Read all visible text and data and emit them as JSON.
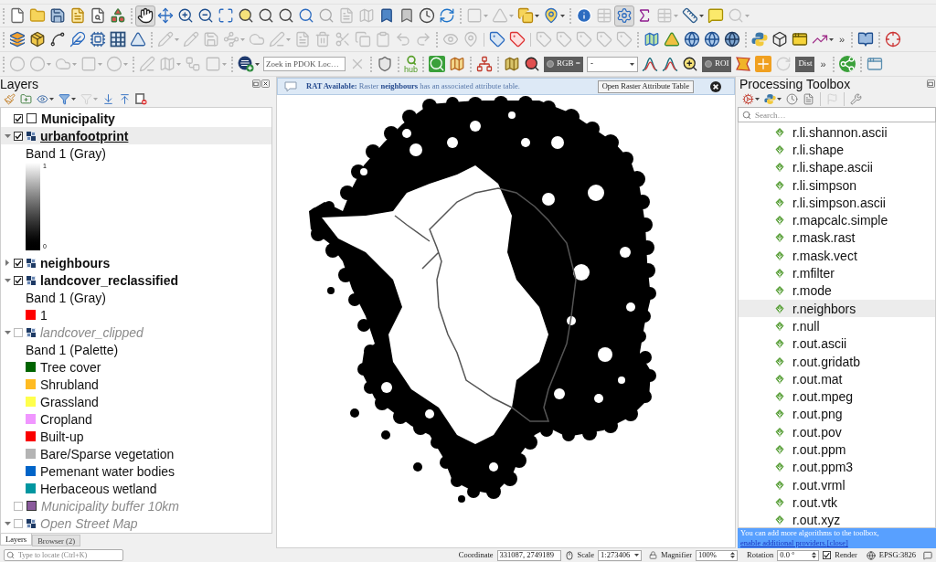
{
  "toolbar_rows": [
    {
      "toolbars": [
        {
          "tools": [
            {
              "kind": "button",
              "disabled": false,
              "selected": false
            },
            {
              "kind": "button",
              "disabled": false,
              "selected": false
            },
            {
              "kind": "button",
              "disabled": false,
              "selected": false
            },
            {
              "kind": "button",
              "disabled": false,
              "selected": false
            },
            {
              "kind": "button",
              "disabled": false,
              "selected": false
            },
            {
              "kind": "button",
              "disabled": false,
              "selected": false
            }
          ]
        },
        {
          "tools": [
            {
              "kind": "button",
              "disabled": false,
              "selected": true
            },
            {
              "kind": "button",
              "disabled": false,
              "selected": false
            },
            {
              "kind": "button",
              "disabled": false,
              "selected": false
            },
            {
              "kind": "button",
              "disabled": false,
              "selected": false
            },
            {
              "kind": "button",
              "disabled": false,
              "selected": false
            },
            {
              "kind": "button",
              "disabled": false,
              "selected": false
            },
            {
              "kind": "button",
              "disabled": false,
              "selected": false
            },
            {
              "kind": "button",
              "disabled": false,
              "selected": false
            },
            {
              "kind": "button",
              "disabled": false,
              "selected": false
            },
            {
              "kind": "button",
              "disabled": true,
              "selected": false
            },
            {
              "kind": "button",
              "disabled": true,
              "selected": false
            },
            {
              "kind": "button",
              "disabled": true,
              "selected": false
            },
            {
              "kind": "button",
              "disabled": false,
              "selected": false
            },
            {
              "kind": "button",
              "disabled": false,
              "selected": false
            },
            {
              "kind": "button",
              "disabled": false,
              "selected": false
            },
            {
              "kind": "button",
              "disabled": false,
              "selected": false
            }
          ]
        },
        {
          "tools": [
            {
              "kind": "button",
              "disabled": true,
              "selected": false
            },
            {
              "kind": "button",
              "disabled": true,
              "selected": false
            },
            {
              "kind": "button",
              "disabled": false,
              "selected": false
            },
            {
              "kind": "button",
              "disabled": false,
              "selected": false
            }
          ]
        },
        {
          "tools": [
            {
              "kind": "button",
              "disabled": false,
              "selected": false
            },
            {
              "kind": "button",
              "disabled": true,
              "selected": false
            },
            {
              "kind": "button",
              "disabled": false,
              "selected": true
            },
            {
              "kind": "button",
              "disabled": false,
              "selected": false
            },
            {
              "kind": "button",
              "disabled": true,
              "selected": false
            },
            {
              "kind": "button",
              "disabled": false,
              "selected": false
            },
            {
              "kind": "button",
              "disabled": false,
              "selected": false
            },
            {
              "kind": "button",
              "disabled": true,
              "selected": false
            }
          ]
        }
      ]
    },
    {
      "toolbars": [
        {
          "tools": [
            {
              "kind": "button",
              "disabled": false,
              "selected": false
            },
            {
              "kind": "button",
              "disabled": false,
              "selected": false
            },
            {
              "kind": "button",
              "disabled": false,
              "selected": false
            },
            {
              "kind": "button",
              "disabled": false,
              "selected": false
            },
            {
              "kind": "button",
              "disabled": false,
              "selected": false
            },
            {
              "kind": "button",
              "disabled": false,
              "selected": false
            },
            {
              "kind": "button",
              "disabled": false,
              "selected": false
            }
          ]
        },
        {
          "tools": [
            {
              "kind": "button",
              "disabled": true,
              "selected": false
            },
            {
              "kind": "button",
              "disabled": true,
              "selected": false
            },
            {
              "kind": "button",
              "disabled": true,
              "selected": false
            },
            {
              "kind": "button",
              "disabled": true,
              "selected": false
            },
            {
              "kind": "button",
              "disabled": true,
              "selected": false
            },
            {
              "kind": "button",
              "disabled": true,
              "selected": false
            },
            {
              "kind": "button",
              "disabled": true,
              "selected": false
            },
            {
              "kind": "button",
              "disabled": true,
              "selected": false
            },
            {
              "kind": "button",
              "disabled": true,
              "selected": false
            },
            {
              "kind": "button",
              "disabled": true,
              "selected": false
            },
            {
              "kind": "button",
              "disabled": true,
              "selected": false
            },
            {
              "kind": "button",
              "disabled": true,
              "selected": false
            },
            {
              "kind": "button",
              "disabled": true,
              "selected": false
            }
          ]
        },
        {
          "tools": [
            {
              "kind": "button",
              "disabled": true,
              "selected": false
            },
            {
              "kind": "button",
              "disabled": true,
              "selected": false
            },
            {
              "kind": "button",
              "disabled": false,
              "selected": false
            },
            {
              "kind": "button",
              "disabled": false,
              "selected": false
            },
            {
              "kind": "button",
              "disabled": true,
              "selected": false
            },
            {
              "kind": "button",
              "disabled": true,
              "selected": false
            },
            {
              "kind": "button",
              "disabled": true,
              "selected": false
            },
            {
              "kind": "button",
              "disabled": true,
              "selected": false
            },
            {
              "kind": "button",
              "disabled": true,
              "selected": false
            }
          ]
        },
        {
          "tools": [
            {
              "kind": "button",
              "disabled": false,
              "selected": false
            },
            {
              "kind": "button",
              "disabled": false,
              "selected": false
            },
            {
              "kind": "button",
              "disabled": false,
              "selected": false
            },
            {
              "kind": "button",
              "disabled": false,
              "selected": false
            },
            {
              "kind": "button",
              "disabled": false,
              "selected": false
            }
          ]
        },
        {
          "tools": [
            {
              "kind": "button",
              "disabled": false,
              "selected": false
            },
            {
              "kind": "button",
              "disabled": false,
              "selected": false
            },
            {
              "kind": "button",
              "disabled": false,
              "selected": false
            },
            {
              "kind": "button",
              "disabled": false,
              "selected": false
            },
            {
              "kind": "more",
              "text": "»"
            }
          ]
        },
        {
          "tools": [
            {
              "kind": "button",
              "disabled": false,
              "selected": false
            }
          ]
        },
        {
          "tools": [
            {
              "kind": "button",
              "disabled": false,
              "selected": false
            }
          ]
        }
      ]
    },
    {
      "toolbars": [
        {
          "tools": [
            {
              "kind": "button",
              "disabled": true,
              "selected": false
            },
            {
              "kind": "button",
              "disabled": true,
              "selected": false
            },
            {
              "kind": "button",
              "disabled": true,
              "selected": false
            },
            {
              "kind": "button",
              "disabled": true,
              "selected": false
            },
            {
              "kind": "button",
              "disabled": true,
              "selected": false
            }
          ]
        },
        {
          "tools": [
            {
              "kind": "button",
              "disabled": true,
              "selected": false
            },
            {
              "kind": "button",
              "disabled": true,
              "selected": false
            },
            {
              "kind": "button",
              "disabled": true,
              "selected": false
            },
            {
              "kind": "button",
              "disabled": true,
              "selected": false
            }
          ]
        },
        {
          "tools": [
            {
              "kind": "button",
              "disabled": false,
              "selected": false
            },
            {
              "kind": "search",
              "placeholder": "Zoek in PDOK Loc…"
            },
            {
              "kind": "button",
              "disabled": true,
              "selected": false
            }
          ]
        },
        {
          "tools": [
            {
              "kind": "button",
              "disabled": false,
              "selected": false
            }
          ]
        },
        {
          "tools": [
            {
              "kind": "button",
              "label": "hub",
              "disabled": false,
              "selected": false
            }
          ]
        },
        {
          "tools": [
            {
              "kind": "button",
              "disabled": false,
              "selected": false
            },
            {
              "kind": "button",
              "disabled": false,
              "selected": false
            }
          ]
        },
        {
          "tools": [
            {
              "kind": "button",
              "disabled": false,
              "selected": false
            }
          ]
        },
        {
          "tools": [
            {
              "kind": "button",
              "disabled": false,
              "selected": false
            },
            {
              "kind": "button",
              "disabled": false,
              "selected": false
            },
            {
              "kind": "toggle",
              "text": "RGB =",
              "indicator": true
            },
            {
              "kind": "combo",
              "value": "-"
            },
            {
              "kind": "button",
              "disabled": false,
              "selected": false
            },
            {
              "kind": "button",
              "disabled": false,
              "selected": false
            },
            {
              "kind": "button",
              "disabled": false,
              "selected": false
            },
            {
              "kind": "toggle",
              "text": "ROI",
              "indicator": true
            },
            {
              "kind": "button",
              "disabled": false,
              "selected": false
            },
            {
              "kind": "button",
              "disabled": false,
              "selected": false
            },
            {
              "kind": "button",
              "disabled": true,
              "selected": false
            },
            {
              "kind": "toggle",
              "text": "Dist",
              "indicator": false
            },
            {
              "kind": "more",
              "text": "»"
            }
          ]
        },
        {
          "tools": [
            {
              "kind": "button",
              "disabled": false,
              "selected": false
            }
          ]
        },
        {
          "tools": [
            {
              "kind": "button",
              "disabled": false,
              "selected": false
            }
          ]
        }
      ]
    }
  ],
  "layers_panel": {
    "title": "Layers",
    "tools": [
      {
        "disabled": false
      },
      {
        "disabled": false
      },
      {
        "disabled": false
      },
      {
        "disabled": false
      },
      {
        "disabled": true
      },
      {
        "disabled": false
      },
      {
        "disabled": false
      },
      {
        "disabled": false
      }
    ],
    "layers": [
      {
        "name": "Municipality",
        "kind": "vector",
        "color": "#ffffff",
        "checked": true,
        "selected": false
      },
      {
        "name": "urbanfootprint",
        "kind": "raster",
        "checked": true,
        "selected": true,
        "expanded": true,
        "legend": {
          "band": "Band 1 (Gray)",
          "kind": "gradient",
          "max": "1",
          "min": "0"
        }
      },
      {
        "name": "neighbours",
        "kind": "raster",
        "checked": true,
        "selected": false,
        "expanded": false
      },
      {
        "name": "landcover_reclassified",
        "kind": "raster",
        "checked": true,
        "selected": false,
        "expanded": true,
        "legend": {
          "band": "Band 1 (Gray)",
          "kind": "classes",
          "classes": [
            {
              "label": "1",
              "color": "#ff0000"
            }
          ]
        }
      },
      {
        "name": "landcover_clipped",
        "kind": "raster",
        "checked": false,
        "selected": false,
        "expanded": true,
        "legend": {
          "band": "Band 1 (Palette)",
          "kind": "classes",
          "classes": [
            {
              "label": "Tree cover",
              "color": "#006400"
            },
            {
              "label": "Shrubland",
              "color": "#ffbb22"
            },
            {
              "label": "Grassland",
              "color": "#ffff4c"
            },
            {
              "label": "Cropland",
              "color": "#f096ff"
            },
            {
              "label": "Built-up",
              "color": "#fa0000"
            },
            {
              "label": "Bare/Sparse vegetation",
              "color": "#b4b4b4"
            },
            {
              "label": "Pemenant water bodies",
              "color": "#0064c8"
            },
            {
              "label": "Herbaceous wetland",
              "color": "#0096a0"
            }
          ]
        }
      },
      {
        "name": "Municipality buffer 10km",
        "kind": "vector",
        "color": "#8a5a9c",
        "checked": false,
        "selected": false
      },
      {
        "name": "Open Street Map",
        "kind": "raster",
        "checked": false,
        "selected": false,
        "expanded": true
      }
    ],
    "tabs": [
      {
        "label": "Layers",
        "selected": true
      },
      {
        "label": "Browser (2)",
        "selected": false
      }
    ]
  },
  "map": {
    "message": {
      "text": "**RAT Available:** Raster **neighbours** has an associated attribute table.",
      "button": "Open Raster Attribute Table"
    }
  },
  "processing_toolbox": {
    "title": "Processing Toolbox",
    "tools": [
      {
        "disabled": false
      },
      {
        "disabled": false
      },
      {
        "disabled": false
      },
      {
        "disabled": false
      },
      {
        "disabled": true
      },
      {
        "disabled": false
      }
    ],
    "search_placeholder": "Search…",
    "algorithms": [
      {
        "name": "r.li.shannon.ascii",
        "selected": false
      },
      {
        "name": "r.li.shape",
        "selected": false
      },
      {
        "name": "r.li.shape.ascii",
        "selected": false
      },
      {
        "name": "r.li.simpson",
        "selected": false
      },
      {
        "name": "r.li.simpson.ascii",
        "selected": false
      },
      {
        "name": "r.mapcalc.simple",
        "selected": false
      },
      {
        "name": "r.mask.rast",
        "selected": false
      },
      {
        "name": "r.mask.vect",
        "selected": false
      },
      {
        "name": "r.mfilter",
        "selected": false
      },
      {
        "name": "r.mode",
        "selected": false
      },
      {
        "name": "r.neighbors",
        "selected": true
      },
      {
        "name": "r.null",
        "selected": false
      },
      {
        "name": "r.out.ascii",
        "selected": false
      },
      {
        "name": "r.out.gridatb",
        "selected": false
      },
      {
        "name": "r.out.mat",
        "selected": false
      },
      {
        "name": "r.out.mpeg",
        "selected": false
      },
      {
        "name": "r.out.png",
        "selected": false
      },
      {
        "name": "r.out.pov",
        "selected": false
      },
      {
        "name": "r.out.ppm",
        "selected": false
      },
      {
        "name": "r.out.ppm3",
        "selected": false
      },
      {
        "name": "r.out.vrml",
        "selected": false
      },
      {
        "name": "r.out.vtk",
        "selected": false
      },
      {
        "name": "r.out.xyz",
        "selected": false
      }
    ],
    "notice": {
      "text": "You can add more algorithms to the toolbox,",
      "link": "enable additional providers.",
      "close": "[close]"
    }
  },
  "status_bar": {
    "locator_placeholder": "Type to locate (Ctrl+K)",
    "coordinate_label": "Coordinate",
    "coordinate": "331087, 2749189",
    "scale_label": "Scale",
    "scale": "1:273406",
    "magnifier_label": "Magnifier",
    "magnifier": "100%",
    "rotation_label": "Rotation",
    "rotation": "0.0 °",
    "render_label": "Render",
    "render_checked": true,
    "crs": "EPSG:3826"
  }
}
